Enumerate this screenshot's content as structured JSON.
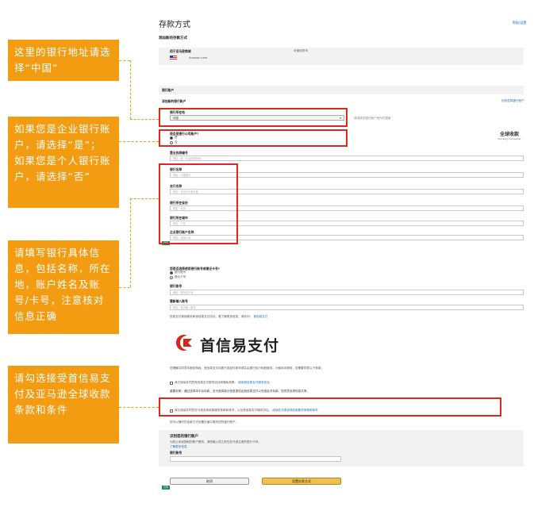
{
  "page": {
    "title": "存款方式",
    "top_right_link": "帮助/设置",
    "section_heading": "添加新的存款方式"
  },
  "callouts": [
    {
      "text": "这里的银行地址请选择“中国“"
    },
    {
      "text": "如果您是企业银行账户，请选择“是”；  如果您是个人银行账户，请选择“否”"
    },
    {
      "text": "请填写银行具体信息，包括名称，所在地，账户姓名及账号/卡号，注意核对信息正确"
    },
    {
      "text": "请勾选接受首信易支付及亚马逊全球收款条款和条件"
    }
  ],
  "marketplace": {
    "label": "用于亚马逊商城",
    "store": "Amazon.com",
    "mid_label": "可使用货币",
    "right_label": ""
  },
  "bank_section": {
    "band_label": "银行账户",
    "heading": "添加新的银行账户",
    "right_link": "如何选择银行账户",
    "location_label": "银行所在地",
    "location_value": "中国",
    "location_note": "请选择您银行账户的所在国家",
    "company_question": "是否是银行公司账户?",
    "yes": "是",
    "no": "否",
    "currency_badge_line1": "全球收款",
    "currency_badge_line2": "Currency Converter",
    "id_label": "营业执照编号",
    "id_placeholder": "例如：统一社会信用代码",
    "bank_name_label": "银行名称",
    "bank_name_placeholder": "例如：中国银行",
    "branch_label": "支行名称",
    "branch_placeholder": "例如：北京分行营业部",
    "province_label": "银行所在省份",
    "province_placeholder": "例如：北京",
    "city_label": "银行所在城市",
    "city_placeholder": "例如：广东",
    "account_name_label": "企业银行账户名称",
    "account_name_placeholder": "例如：张某公司",
    "green_chip": "已有"
  },
  "card_section": {
    "question": "您是否选择使用银行账号或借记卡号?",
    "opt1": "银行账号",
    "opt2": "借记卡号",
    "account_label": "银行账号",
    "account_placeholder": "例如：账号或卡号",
    "reenter_label": "重新输入账号",
    "reenter_placeholder": "例如：再次输入账号",
    "note": "您将支付使用服务和首信易支付协议。看了解更多信息，请访问：",
    "note_link": "首信易支付"
  },
  "payease": {
    "brand": "首信易支付",
    "para1": "您理解并同意本服务条款。首信易支付向银行发起付款申请并由银行执行转账服务。为使用本服务，您需要同意以下条款。",
    "checkbox1": "我已阅读并同意首信易支付服务协议和隐私政策。",
    "checkbox1_link": "阅读首信易支付服务协议",
    "para2": "重要说明：通过选择本平台存款，亚马逊将部分信息提供给首信易支付以完成此次存款。您同意此项信息共享。",
    "checkbox2": "我已阅读并同意亚马逊全球收款服务条款和条件，以及首信易支付服务协议。",
    "checkbox2_link": "阅读亚马逊全球收款服务条款和条件",
    "footer_note": "您可以随时在存款方式设置页面中更改您的银行账户。"
  },
  "verify_section": {
    "heading": "识别您的银行账户",
    "desc": "为防止未经授权的账户更改，请您输入您之前在亚马逊注册的银行卡号。",
    "link": "了解更多信息",
    "field_label": "银行账号"
  },
  "actions": {
    "cancel": "取消",
    "submit": "设置存款方式",
    "chip": "已有"
  },
  "colors": {
    "callout": "#f39c12",
    "highlight_border": "#e0261d",
    "submit_button": "#f0c14b",
    "payease_red": "#d6261e"
  }
}
